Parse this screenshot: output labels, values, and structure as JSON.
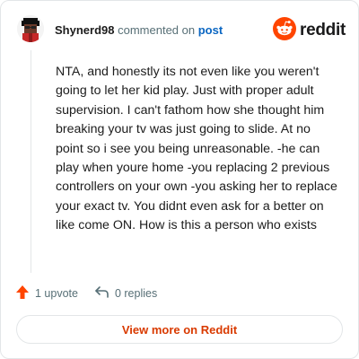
{
  "comment": {
    "author": "Shynerd98",
    "action_text": "commented on",
    "post_link": "post",
    "body": "NTA, and honestly its not even like you weren't going to let her kid play. Just with proper adult supervision. I can't fathom how she thought him breaking your tv was just going to slide. At no point so i see you being unreasonable. -he can play when youre home -you replacing 2 previous controllers on your own -you asking her to replace your exact tv. You didnt even ask for a better on like come ON. How is this a person who exists"
  },
  "brand": {
    "name": "reddit",
    "accent": "#ff4500"
  },
  "stats": {
    "upvotes": "1 upvote",
    "replies": "0 replies"
  },
  "cta": {
    "label": "View more on Reddit"
  },
  "colors": {
    "upvote_icon": "#ff4500",
    "link": "#0a66c2",
    "cta_text": "#d93a00",
    "muted": "#576f76"
  },
  "icons": {
    "upvote": "upvote-arrow-icon",
    "reply": "reply-arrow-icon",
    "logo": "reddit-snoo-icon"
  }
}
